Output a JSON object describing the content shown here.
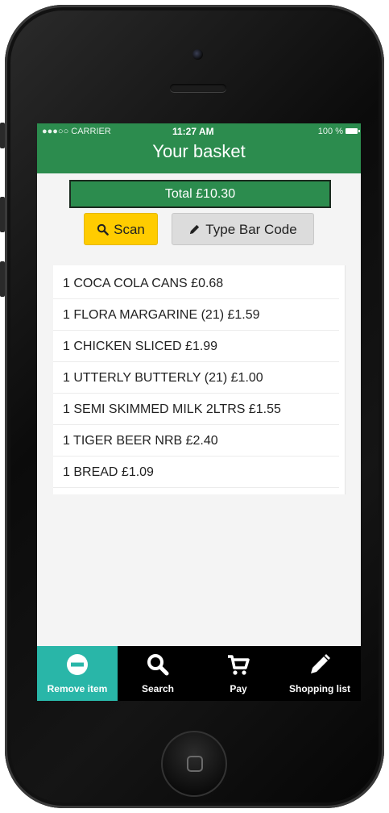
{
  "status_bar": {
    "carrier": "●●●○○ CARRIER",
    "time": "11:27 AM",
    "battery": "100 %"
  },
  "header": {
    "title": "Your basket"
  },
  "total": {
    "label": "Total £10.30"
  },
  "actions": {
    "scan_label": "Scan",
    "type_barcode_label": "Type Bar Code"
  },
  "basket_items": [
    "1 COCA COLA CANS £0.68",
    "1 FLORA MARGARINE (21) £1.59",
    "1 CHICKEN SLICED £1.99",
    "1 UTTERLY BUTTERLY (21) £1.00",
    "1 SEMI SKIMMED MILK 2LTRS £1.55",
    "1 TIGER BEER NRB £2.40",
    "1 BREAD £1.09"
  ],
  "tabbar": {
    "items": [
      {
        "label": "Remove item",
        "icon": "remove-icon",
        "active": true
      },
      {
        "label": "Search",
        "icon": "search-icon",
        "active": false
      },
      {
        "label": "Pay",
        "icon": "cart-icon",
        "active": false
      },
      {
        "label": "Shopping list",
        "icon": "pencil-icon",
        "active": false
      }
    ]
  },
  "colors": {
    "header_green": "#2c8c4e",
    "scan_yellow": "#ffcc00",
    "active_tab_teal": "#29b6a8"
  }
}
